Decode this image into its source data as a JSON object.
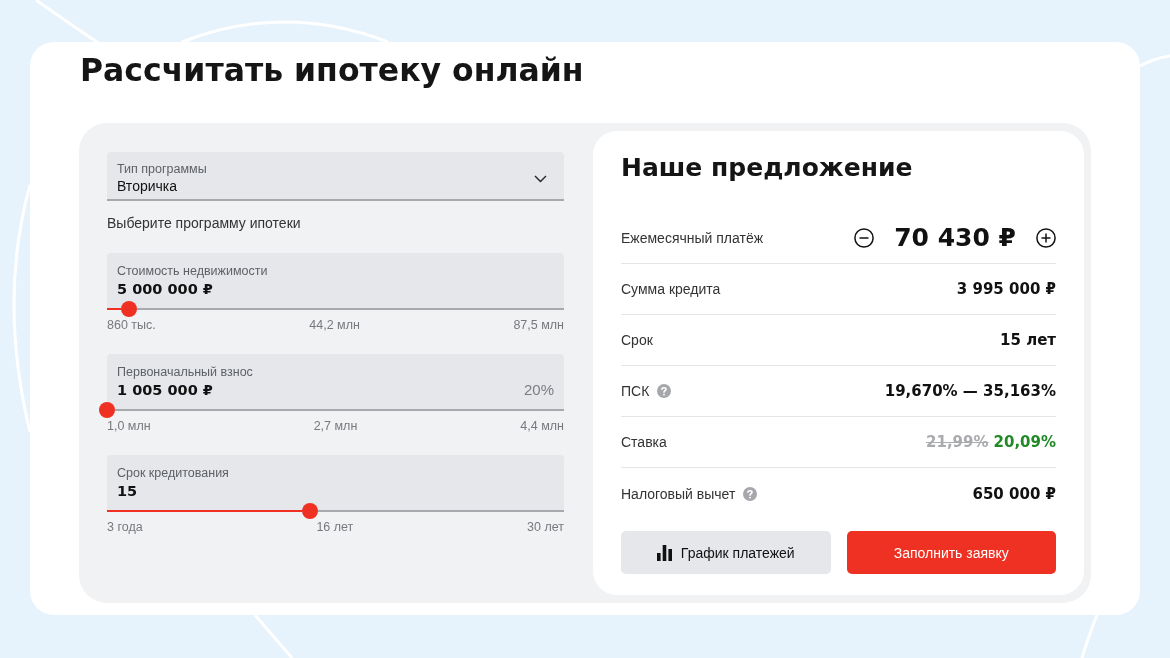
{
  "page": {
    "title": "Рассчитать ипотеку онлайн"
  },
  "calculator": {
    "program_select": {
      "label": "Тип программы",
      "value": "Вторичка",
      "hint": "Выберите программу ипотеки"
    },
    "sliders": [
      {
        "label": "Стоимость недвижимости",
        "value": "5 000 000 ₽",
        "level": 0.048,
        "ticks": [
          "860 тыс.",
          "44,2 млн",
          "87,5 млн"
        ]
      },
      {
        "label": "Первоначальный взнос",
        "value": "1 005 000 ₽",
        "share": "20%",
        "level": 0,
        "ticks": [
          "1,0 млн",
          "2,7 млн",
          "4,4 млн"
        ]
      },
      {
        "label": "Срок кредитования",
        "value": "15",
        "level": 0.444,
        "ticks": [
          "3 года",
          "16 лет",
          "30 лет"
        ]
      }
    ]
  },
  "offer": {
    "title": "Наше предложение",
    "rows": [
      {
        "kind": "stepper",
        "label": "Ежемесячный платёж",
        "value": "70 430 ₽",
        "info": false
      },
      {
        "kind": "plain",
        "label": "Сумма кредита",
        "value": "3 995 000 ₽",
        "info": false
      },
      {
        "kind": "plain",
        "label": "Срок",
        "value": "15 лет",
        "info": false
      },
      {
        "kind": "plain",
        "label": "ПСК",
        "value": "19,670% — 35,163%",
        "info": true
      },
      {
        "kind": "discount",
        "label": "Ставка",
        "old_value": "21,99%",
        "value": "20,09%",
        "info": false
      },
      {
        "kind": "plain",
        "label": "Налоговый вычет",
        "value": "650 000 ₽",
        "info": true
      }
    ],
    "buttons": [
      {
        "kind": "secondary",
        "label": "График платежей"
      },
      {
        "kind": "primary",
        "label": "Заполнить заявку"
      }
    ]
  }
}
